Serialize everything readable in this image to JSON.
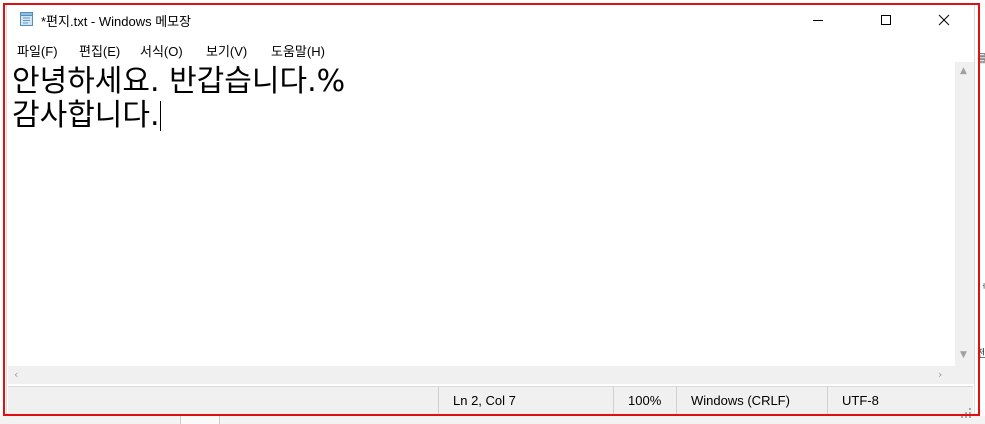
{
  "window": {
    "title": "*편지.txt - Windows 메모장"
  },
  "title_controls": {
    "minimize_icon": "minimize-icon",
    "maximize_icon": "maximize-icon",
    "close_icon": "close-icon"
  },
  "menu": {
    "items": [
      {
        "label": "파일(F)"
      },
      {
        "label": "편집(E)"
      },
      {
        "label": "서식(O)"
      },
      {
        "label": "보기(V)"
      },
      {
        "label": "도움말(H)"
      }
    ]
  },
  "editor": {
    "lines": [
      "안녕하세요. 반갑습니다.%",
      "감사합니다."
    ]
  },
  "status": {
    "position": "Ln 2, Col 7",
    "zoom": "100%",
    "line_ending": "Windows (CRLF)",
    "encoding": "UTF-8"
  },
  "colors": {
    "highlight_frame": "#e01010",
    "statusbar_bg": "#f0f0f0"
  }
}
